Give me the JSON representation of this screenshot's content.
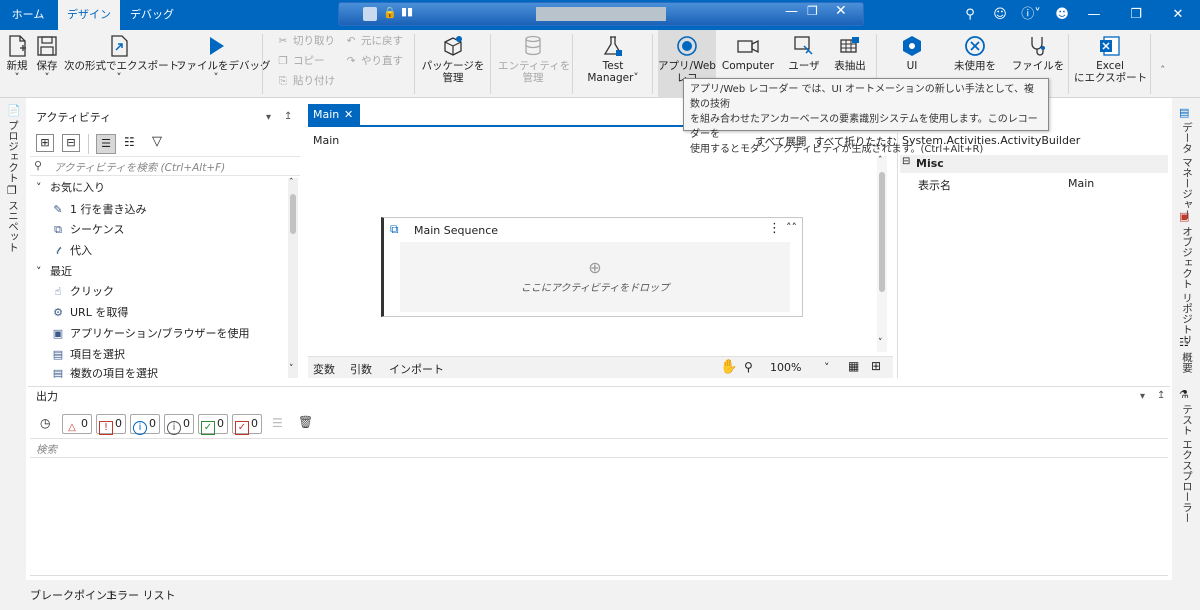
{
  "titlebar": {
    "tabs": [
      {
        "label": "ホーム"
      },
      {
        "label": "デザイン"
      },
      {
        "label": "デバッグ"
      }
    ],
    "accent": "#0067c0"
  },
  "ribbon": {
    "new": "新規",
    "save": "保存",
    "export": "次の形式でエクスポート:",
    "debug_file": "ファイルをデバッグ",
    "cut": "切り取り",
    "copy": "コピー",
    "paste": "貼り付け",
    "undo": "元に戻す",
    "redo": "やり直す",
    "manage_packages_1": "パッケージを",
    "manage_packages_2": "管理",
    "entities_1": "エンティティを",
    "entities_2": "管理",
    "test_manager_1": "Test",
    "test_manager_2": "Manager",
    "app_web_1": "アプリ/Web",
    "app_web_2": "レコ",
    "computer": "Computer",
    "user": "ユーザ",
    "table_extract": "表抽出",
    "ui": "UI",
    "unused": "未使用を",
    "file": "ファイルを",
    "excel_1": "Excel",
    "excel_2": "にエクスポート"
  },
  "tooltip": {
    "line1": "アプリ/Web レコーダー では、UI オートメーションの新しい手法として、複数の技術",
    "line2": "を組み合わせたアンカーベースの要素識別システムを使用します。このレコーダーを",
    "line3": "使用するとモダン アクティビティが生成されます。(Ctrl+Alt+R)"
  },
  "left_strip": {
    "project": "プロジェクト",
    "snippets": "スニペット"
  },
  "activities": {
    "title": "アクティビティ",
    "search_placeholder": "アクティビティを検索 (Ctrl+Alt+F)",
    "favorites": "お気に入り",
    "fav_items": [
      "1 行を書き込み",
      "シーケンス",
      "代入"
    ],
    "recent": "最近",
    "recent_items": [
      "クリック",
      "URL を取得",
      "アプリケーション/ブラウザーを使用",
      "項目を選択",
      "複数の項目を選択"
    ]
  },
  "designer": {
    "tab": "Main",
    "breadcrumb": "Main",
    "expand_all": "すべて展開",
    "collapse_all": "すべて折りたたむ",
    "sequence_title": "Main Sequence",
    "drop_hint": "ここにアクティビティをドロップ",
    "variables": "変数",
    "arguments": "引数",
    "imports": "インポート",
    "zoom": "100%"
  },
  "properties": {
    "type": "System.Activities.ActivityBuilder",
    "category": "Misc",
    "prop_name": "表示名",
    "prop_value": "Main"
  },
  "output": {
    "title": "出力",
    "counts": [
      "0",
      "0",
      "0",
      "0",
      "0",
      "0"
    ],
    "search_placeholder": "検索"
  },
  "bottom": {
    "breakpoints": "ブレークポイント",
    "error_list": "エラー リスト"
  },
  "right_strip": {
    "data_manager": "データ マネージャー",
    "object_repo": "オブジェクト リポジトリ",
    "outline": "概要",
    "test_explorer": "テスト エクスプローラー"
  }
}
